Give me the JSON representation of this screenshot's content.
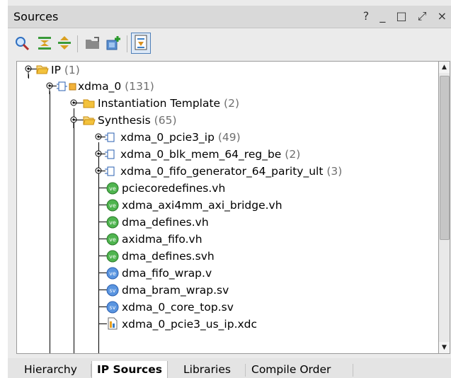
{
  "panel": {
    "title": "Sources",
    "controls": [
      "?",
      "_",
      "□",
      "⤢",
      "×"
    ]
  },
  "toolbar": {
    "icons": [
      "search-icon",
      "collapse-all-icon",
      "expand-all-icon",
      "open-folder-icon",
      "add-sources-icon",
      "hierarchy-update-icon"
    ]
  },
  "tree": {
    "rows": [
      {
        "label": "IP",
        "count": "(1)",
        "icon": "folder-open-icon"
      },
      {
        "label": "xdma_0",
        "count": "(131)",
        "icon": "ip-core-icon"
      },
      {
        "label": "Instantiation Template",
        "count": "(2)",
        "icon": "folder-closed-icon"
      },
      {
        "label": "Synthesis",
        "count": "(65)",
        "icon": "folder-open-icon"
      },
      {
        "label": "xdma_0_pcie3_ip",
        "count": "(49)",
        "icon": "ip-module-icon"
      },
      {
        "label": "xdma_0_blk_mem_64_reg_be",
        "count": "(2)",
        "icon": "ip-module-icon"
      },
      {
        "label": "xdma_0_fifo_generator_64_parity_ult",
        "count": "(3)",
        "icon": "ip-module-icon"
      },
      {
        "label": "pciecoredefines.vh",
        "count": "",
        "icon": "verilog-header-icon"
      },
      {
        "label": "xdma_axi4mm_axi_bridge.vh",
        "count": "",
        "icon": "verilog-header-icon"
      },
      {
        "label": "dma_defines.vh",
        "count": "",
        "icon": "verilog-header-icon"
      },
      {
        "label": "axidma_fifo.vh",
        "count": "",
        "icon": "verilog-header-icon"
      },
      {
        "label": "dma_defines.svh",
        "count": "",
        "icon": "verilog-header-icon"
      },
      {
        "label": "dma_fifo_wrap.v",
        "count": "",
        "icon": "verilog-file-icon"
      },
      {
        "label": "dma_bram_wrap.sv",
        "count": "",
        "icon": "systemverilog-file-icon"
      },
      {
        "label": "xdma_0_core_top.sv",
        "count": "",
        "icon": "systemverilog-file-icon"
      },
      {
        "label": "xdma_0_pcie3_us_ip.xdc",
        "count": "",
        "icon": "constraints-file-icon"
      }
    ],
    "badges": {
      "ve": "ve",
      "vo": "ve",
      "sv": "sv"
    }
  },
  "tabs": [
    {
      "label": "Hierarchy",
      "selected": false
    },
    {
      "label": "IP Sources",
      "selected": true
    },
    {
      "label": "Libraries",
      "selected": false
    },
    {
      "label": "Compile Order",
      "selected": false
    }
  ],
  "colors": {
    "folder": "#e8a820",
    "vh_badge": "#3aa23a",
    "v_badge": "#3b7fd6",
    "sv_badge": "#3b7fd6"
  }
}
